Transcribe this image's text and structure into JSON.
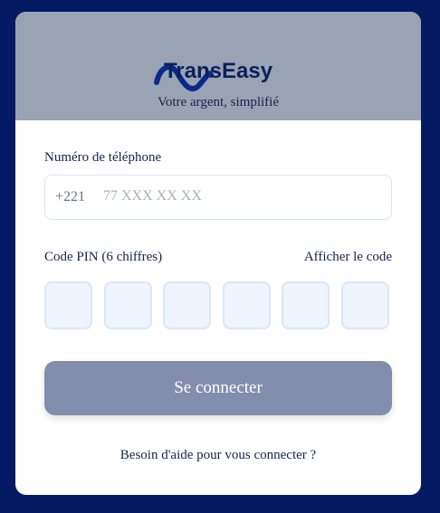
{
  "header": {
    "brand": "TransEasy",
    "tagline": "Votre argent, simplifié",
    "logo_icon": "wave-icon",
    "background": "#9aa3b3",
    "brand_color": "#0b1f5c"
  },
  "phone": {
    "label": "Numéro de téléphone",
    "prefix": "+221",
    "placeholder": "77 XXX XX XX",
    "value": ""
  },
  "pin": {
    "label": "Code PIN (6 chiffres)",
    "toggle_label": "Afficher le code",
    "digits": [
      "",
      "",
      "",
      "",
      "",
      ""
    ]
  },
  "submit": {
    "label": "Se connecter",
    "color": "#838eae"
  },
  "help": {
    "label": "Besoin d'aide pour vous connecter ?"
  },
  "page": {
    "background": "#041b63"
  }
}
